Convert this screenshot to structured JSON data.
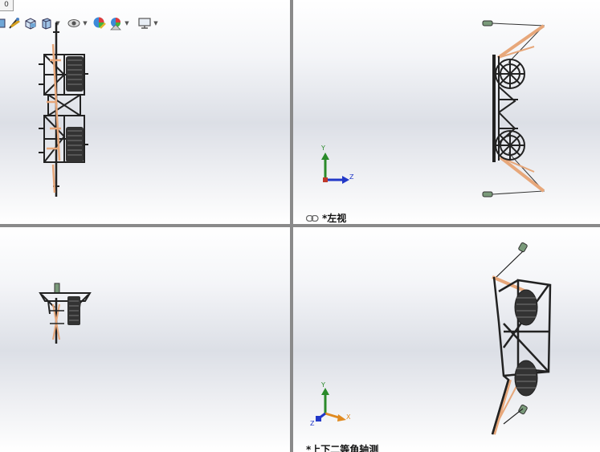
{
  "toolbar": {
    "corner_label": "0",
    "items": [
      {
        "icon": "display-style-icon"
      },
      {
        "icon": "section-view-icon"
      },
      {
        "icon": "view-orientation-icon"
      },
      {
        "icon": "hide-show-items-icon"
      },
      {
        "icon": "edit-appearance-icon"
      },
      {
        "icon": "apply-scene-icon"
      },
      {
        "icon": "view-settings-icon"
      }
    ]
  },
  "viewports": {
    "top_left": {
      "label": ""
    },
    "top_right": {
      "label": "*左视",
      "axes": {
        "y": "Y",
        "z": "Z"
      }
    },
    "bottom_left": {
      "label": ""
    },
    "bottom_right": {
      "label": "*上下二等角轴测",
      "axes": {
        "x": "X",
        "y": "Y",
        "z": "Z"
      }
    }
  },
  "colors": {
    "frame": "#222222",
    "accent_wood": "#e7a77a",
    "axis_x": "#c0392b",
    "axis_y": "#2a8a2a",
    "axis_z": "#2238c8",
    "axis_x_iso": "#e08a20",
    "bumper": "#7a9a7a",
    "divider": "#8a8a8a"
  }
}
